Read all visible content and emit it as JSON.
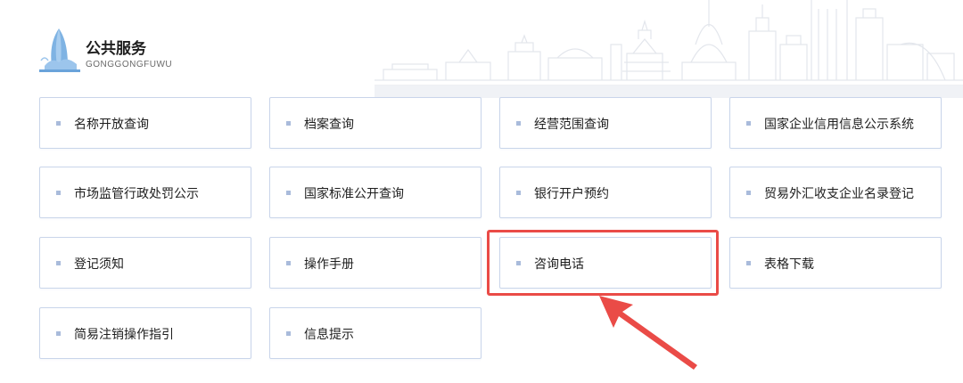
{
  "section": {
    "title": "公共服务",
    "subtitle": "GONGGONGFUWU"
  },
  "services": [
    {
      "label": "名称开放查询"
    },
    {
      "label": "档案查询"
    },
    {
      "label": "经营范围查询"
    },
    {
      "label": "国家企业信用信息公示系统"
    },
    {
      "label": "市场监管行政处罚公示"
    },
    {
      "label": "国家标准公开查询"
    },
    {
      "label": "银行开户预约"
    },
    {
      "label": "贸易外汇收支企业名录登记"
    },
    {
      "label": "登记须知"
    },
    {
      "label": "操作手册"
    },
    {
      "label": "咨询电话"
    },
    {
      "label": "表格下载"
    },
    {
      "label": "简易注销操作指引"
    },
    {
      "label": "信息提示"
    }
  ],
  "highlighted_item": "咨询电话",
  "colors": {
    "card_border": "#c9d5ea",
    "bullet": "#a9bbdb",
    "highlight_red": "#ea4b47",
    "logo_blue": "#7fb3e3"
  },
  "icons": {
    "logo": "city-tower-logo-icon",
    "background": "city-skyline-illustration",
    "annotation": "red-arrow-icon"
  }
}
